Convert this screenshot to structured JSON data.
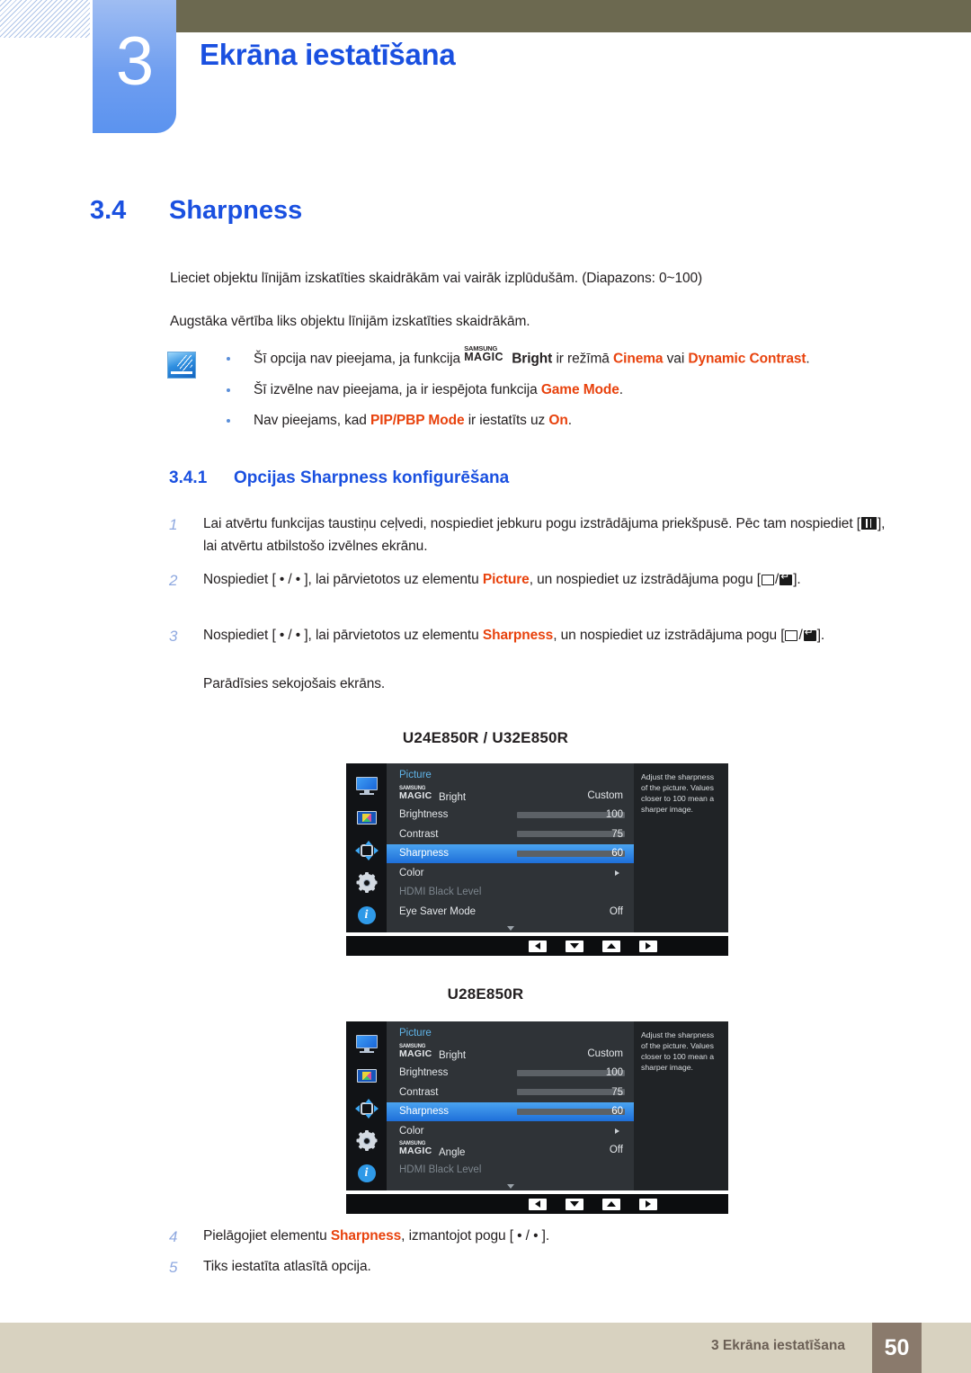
{
  "header": {
    "chapter_number": "3",
    "chapter_title": "Ekrāna iestatīšana"
  },
  "section": {
    "number": "3.4",
    "title": "Sharpness",
    "paragraph1": "Lieciet objektu līnijām izskatīties skaidrākām vai vairāk izplūdušām. (Diapazons: 0~100)",
    "paragraph2": "Augstāka vērtība liks objektu līnijām izskatīties skaidrākām."
  },
  "note": {
    "icon": "note-pen-icon",
    "bullets": [
      {
        "pre": "Šī opcija nav pieejama, ja funkcija ",
        "magic_small": "SAMSUNG",
        "magic_big": "MAGIC",
        "magic_suffix": "Bright",
        "mid": " ir režīmā ",
        "hl1": "Cinema",
        "mid2": " vai ",
        "hl2": "Dynamic Contrast",
        "post": "."
      },
      {
        "pre": "Šī izvēlne nav pieejama, ja ir iespējota funkcija ",
        "hl1": "Game Mode",
        "post": "."
      },
      {
        "pre": "Nav pieejams, kad ",
        "hl1": "PIP/PBP Mode",
        "mid": " ir iestatīts uz ",
        "hl2": "On",
        "post": "."
      }
    ]
  },
  "subsection": {
    "number": "3.4.1",
    "title": "Opcijas Sharpness konfigurēšana"
  },
  "steps": [
    {
      "num": "1",
      "part1": "Lai atvērtu funkcijas taustiņu ceļvedi, nospiediet jebkuru pogu izstrādājuma priekšpusē. Pēc tam nospiediet [",
      "key": "menu-icon",
      "part2": "], lai atvērtu atbilstošo izvēlnes ekrānu."
    },
    {
      "num": "2",
      "part1": "Nospiediet [ • / • ], lai pārvietotos uz elementu ",
      "hl": "Picture",
      "part2": ", un nospiediet uz izstrādājuma pogu [",
      "key1": "back-icon",
      "sep": "/",
      "key2": "enter-icon",
      "part3": "]."
    },
    {
      "num": "3",
      "part1": "Nospiediet [ • / • ], lai pārvietotos uz elementu ",
      "hl": "Sharpness",
      "part2": ", un nospiediet uz izstrādājuma pogu [",
      "key1": "back-icon",
      "sep": "/",
      "key2": "enter-icon",
      "part3": "]."
    },
    {
      "num": "4",
      "part1": "Pielāgojiet elementu ",
      "hl": "Sharpness",
      "part2": ", izmantojot pogu [ • / • ]."
    },
    {
      "num": "5",
      "part1": "Tiks iestatīta atlasītā opcija."
    }
  ],
  "screen_note": "Parādīsies sekojošais ekrāns.",
  "osd_screens": [
    {
      "model_label": "U24E850R / U32E850R",
      "menu_title": "Picture",
      "description": "Adjust the sharpness of the picture. Values closer to 100 mean a sharper image.",
      "rail_icons": [
        "monitor-icon",
        "picture-color-icon",
        "pip-arrows-icon",
        "gear-icon",
        "info-icon"
      ],
      "rows": [
        {
          "label_magic_small": "SAMSUNG",
          "label_magic_big": "MAGIC",
          "label_suffix": "Bright",
          "value": "Custom",
          "type": "value",
          "state": "normal"
        },
        {
          "label": "Brightness",
          "value": "100",
          "type": "slider",
          "fill": 100,
          "state": "normal"
        },
        {
          "label": "Contrast",
          "value": "75",
          "type": "slider",
          "fill": 75,
          "state": "normal"
        },
        {
          "label": "Sharpness",
          "value": "60",
          "type": "slider",
          "fill": 60,
          "state": "selected"
        },
        {
          "label": "Color",
          "value": "",
          "type": "submenu",
          "state": "normal"
        },
        {
          "label": "HDMI Black Level",
          "value": "",
          "type": "value",
          "state": "disabled"
        },
        {
          "label": "Eye Saver Mode",
          "value": "Off",
          "type": "value",
          "state": "normal"
        }
      ],
      "footer_buttons": [
        "left-arrow-button",
        "down-arrow-button",
        "up-arrow-button",
        "right-arrow-button"
      ]
    },
    {
      "model_label": "U28E850R",
      "menu_title": "Picture",
      "description": "Adjust the sharpness of the picture. Values closer to 100 mean a sharper image.",
      "rail_icons": [
        "monitor-icon",
        "picture-color-icon",
        "pip-arrows-icon",
        "gear-icon",
        "info-icon"
      ],
      "rows": [
        {
          "label_magic_small": "SAMSUNG",
          "label_magic_big": "MAGIC",
          "label_suffix": "Bright",
          "value": "Custom",
          "type": "value",
          "state": "normal"
        },
        {
          "label": "Brightness",
          "value": "100",
          "type": "slider",
          "fill": 100,
          "state": "normal"
        },
        {
          "label": "Contrast",
          "value": "75",
          "type": "slider",
          "fill": 75,
          "state": "normal"
        },
        {
          "label": "Sharpness",
          "value": "60",
          "type": "slider",
          "fill": 60,
          "state": "selected"
        },
        {
          "label": "Color",
          "value": "",
          "type": "submenu",
          "state": "normal"
        },
        {
          "label_magic_small": "SAMSUNG",
          "label_magic_big": "MAGIC",
          "label_suffix": "Angle",
          "value": "Off",
          "type": "value",
          "state": "normal"
        },
        {
          "label": "HDMI Black Level",
          "value": "",
          "type": "value",
          "state": "disabled"
        }
      ],
      "footer_buttons": [
        "left-arrow-button",
        "down-arrow-button",
        "up-arrow-button",
        "right-arrow-button"
      ]
    }
  ],
  "footer": {
    "text": "3 Ekrāna iestatīšana",
    "page_number": "50"
  },
  "colors": {
    "accent_blue": "#1a50e0",
    "highlight_orange": "#e8420d",
    "header_olive": "#6c6950",
    "footer_beige": "#d8d2c0",
    "footer_page_brown": "#8a7a6c",
    "osd_selected_blue": "#2a7fe0"
  }
}
